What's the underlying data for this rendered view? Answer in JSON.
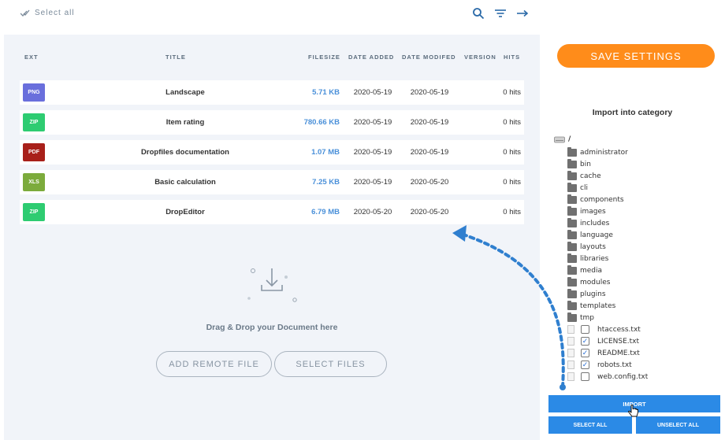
{
  "toolbar": {
    "select_all_label": "Select all",
    "icons": [
      "search-icon",
      "filter-icon",
      "arrow-right-icon"
    ]
  },
  "table": {
    "headers": {
      "ext": "EXT",
      "title": "TITLE",
      "filesize": "FILESIZE",
      "date_added": "DATE ADDED",
      "date_modified": "DATE MODIFED",
      "version": "VERSION",
      "hits": "HITS"
    },
    "rows": [
      {
        "ext": "PNG",
        "color": "#6a6fdc",
        "title": "Landscape",
        "filesize": "5.71 KB",
        "date_added": "2020-05-19",
        "date_modified": "2020-05-19",
        "hits": "0 hits"
      },
      {
        "ext": "ZIP",
        "color": "#2ecc71",
        "title": "Item rating",
        "filesize": "780.66 KB",
        "date_added": "2020-05-19",
        "date_modified": "2020-05-19",
        "hits": "0 hits"
      },
      {
        "ext": "PDF",
        "color": "#a8201a",
        "title": "Dropfiles documentation",
        "filesize": "1.07 MB",
        "date_added": "2020-05-19",
        "date_modified": "2020-05-19",
        "hits": "0 hits"
      },
      {
        "ext": "XLS",
        "color": "#7cab3c",
        "title": "Basic calculation",
        "filesize": "7.25 KB",
        "date_added": "2020-05-19",
        "date_modified": "2020-05-20",
        "hits": "0 hits"
      },
      {
        "ext": "ZIP",
        "color": "#2ecc71",
        "title": "DropEditor",
        "filesize": "6.79 MB",
        "date_added": "2020-05-20",
        "date_modified": "2020-05-20",
        "hits": "0 hits"
      }
    ]
  },
  "dropzone": {
    "text": "Drag & Drop your Document here",
    "add_remote_label": "ADD REMOTE FILE",
    "select_files_label": "SELECT FILES"
  },
  "settings": {
    "save_label": "SAVE SETTINGS",
    "import_title": "Import into category",
    "root_label": "/",
    "folders": [
      "administrator",
      "bin",
      "cache",
      "cli",
      "components",
      "images",
      "includes",
      "language",
      "layouts",
      "libraries",
      "media",
      "modules",
      "plugins",
      "templates",
      "tmp"
    ],
    "files": [
      {
        "name": "htaccess.txt",
        "checked": false
      },
      {
        "name": "LICENSE.txt",
        "checked": true
      },
      {
        "name": "README.txt",
        "checked": true
      },
      {
        "name": "robots.txt",
        "checked": true
      },
      {
        "name": "web.config.txt",
        "checked": false
      }
    ],
    "import_label": "IMPORT",
    "select_all_label": "SELECT ALL",
    "unselect_all_label": "UNSELECT ALL"
  },
  "colors": {
    "accent_orange": "#ff8c1a",
    "accent_blue": "#2b8ae6",
    "filesize_blue": "#4a90d9"
  }
}
